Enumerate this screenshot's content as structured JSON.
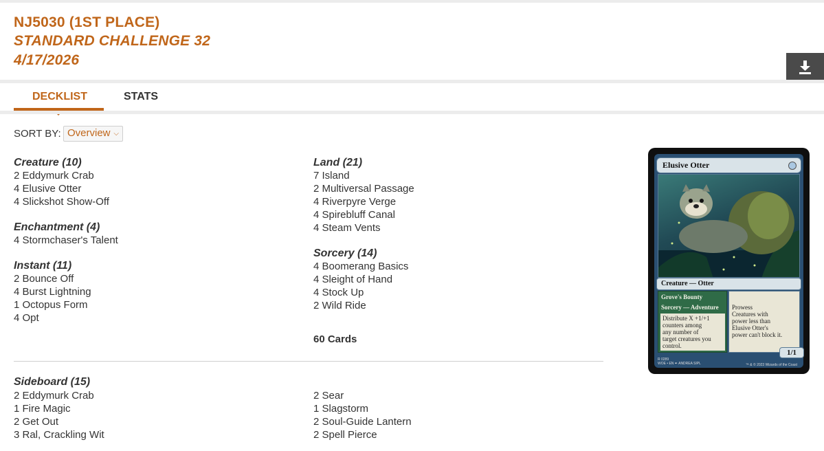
{
  "header": {
    "player": "NJ5030 (1ST PLACE)",
    "event": "STANDARD CHALLENGE 32",
    "date": "4/17/2026",
    "download_icon": "download-icon"
  },
  "tabs": [
    {
      "label": "DECKLIST",
      "active": true
    },
    {
      "label": "STATS",
      "active": false
    }
  ],
  "sort": {
    "label": "SORT BY:",
    "selected": "Overview"
  },
  "maindeck": {
    "left_column": [
      {
        "title": "Creature (10)",
        "cards": [
          "2 Eddymurk Crab",
          "4 Elusive Otter",
          "4 Slickshot Show-Off"
        ]
      },
      {
        "title": "Enchantment (4)",
        "cards": [
          "4 Stormchaser's Talent"
        ]
      },
      {
        "title": "Instant (11)",
        "cards": [
          "2 Bounce Off",
          "4 Burst Lightning",
          "1 Octopus Form",
          "4 Opt"
        ]
      }
    ],
    "right_column": [
      {
        "title": "Land (21)",
        "cards": [
          "7 Island",
          "2 Multiversal Passage",
          "4 Riverpyre Verge",
          "4 Spirebluff Canal",
          "4 Steam Vents"
        ]
      },
      {
        "title": "Sorcery (14)",
        "cards": [
          "4 Boomerang Basics",
          "4 Sleight of Hand",
          "4 Stock Up",
          "2 Wild Ride"
        ]
      }
    ],
    "total": "60 Cards"
  },
  "sideboard": {
    "title": "Sideboard (15)",
    "left": [
      "2 Eddymurk Crab",
      "1 Fire Magic",
      "2 Get Out",
      "3 Ral, Crackling Wit"
    ],
    "right": [
      "2 Sear",
      "1 Slagstorm",
      "2 Soul-Guide Lantern",
      "2 Spell Pierce"
    ]
  },
  "card_preview": {
    "name": "Elusive Otter",
    "type_line": "Creature — Otter",
    "adventure_name": "Grove's Bounty",
    "adventure_type": "Sorcery — Adventure",
    "adventure_text": "Distribute X +1/+1\ncounters among\nany number of\ntarget creatures you\ncontrol.",
    "rules_text": "Prowess\nCreatures with\npower less than\nElusive Otter's\npower can't block it.",
    "pt": "1/1",
    "footer_left": "R 0289\nWOE • EN ✒ ANDREA SIPL",
    "footer_right": "™ & © 2023 Wizards of the Coast"
  }
}
